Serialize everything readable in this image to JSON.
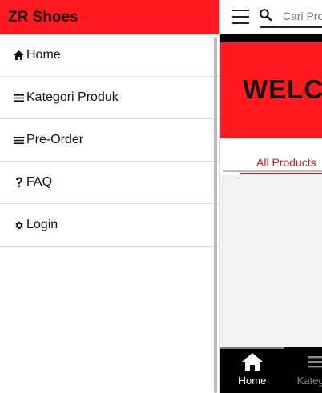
{
  "drawer": {
    "title": "ZR Shoes",
    "items": [
      {
        "label": "Home",
        "icon": "home-icon"
      },
      {
        "label": "Kategori Produk",
        "icon": "menu-lines-icon"
      },
      {
        "label": "Pre-Order",
        "icon": "menu-lines-icon"
      },
      {
        "label": "FAQ",
        "icon": "question-icon"
      },
      {
        "label": "Login",
        "icon": "gear-icon"
      }
    ]
  },
  "topbar": {
    "search_placeholder": "Cari Produk"
  },
  "banner": {
    "text": "WELCOME"
  },
  "tabs": {
    "active_label": "All Products"
  },
  "bottom_nav": {
    "items": [
      {
        "label": "Home",
        "icon": "home-icon",
        "active": true
      },
      {
        "label": "Kategori",
        "icon": "menu-lines-icon",
        "active": false
      }
    ]
  },
  "colors": {
    "brand_red": "#ff1a22",
    "accent_red": "#e0101a",
    "nav_background": "#000000"
  }
}
